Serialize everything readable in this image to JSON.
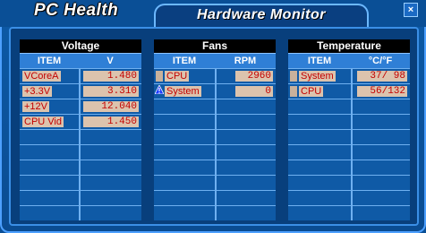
{
  "app": {
    "title": "PC Health",
    "tab_title": "Hardware Monitor",
    "close_glyph": "×"
  },
  "voltage": {
    "title": "Voltage",
    "headers": [
      "ITEM",
      "V"
    ],
    "rows": [
      {
        "item": "VCoreA",
        "value": "1.480"
      },
      {
        "item": "+3.3V",
        "value": "3.310"
      },
      {
        "item": "+12V",
        "value": "12.040"
      },
      {
        "item": "CPU Vid",
        "value": "1.450"
      }
    ]
  },
  "fans": {
    "title": "Fans",
    "headers": [
      "ITEM",
      "RPM"
    ],
    "rows": [
      {
        "item": "CPU",
        "value": "2960",
        "icon": "marker"
      },
      {
        "item": "System",
        "value": "0",
        "icon": "warning-icon"
      }
    ]
  },
  "temperature": {
    "title": "Temperature",
    "headers": [
      "ITEM",
      "°C/°F"
    ],
    "rows": [
      {
        "item": "System",
        "value": "37/ 98",
        "icon": "marker"
      },
      {
        "item": "CPU",
        "value": "56/132",
        "icon": "marker"
      }
    ]
  },
  "colors": {
    "background": "#0a4f96",
    "value_text": "#c40000",
    "value_bg": "#dcc3ad",
    "header_bar": "#000000"
  }
}
